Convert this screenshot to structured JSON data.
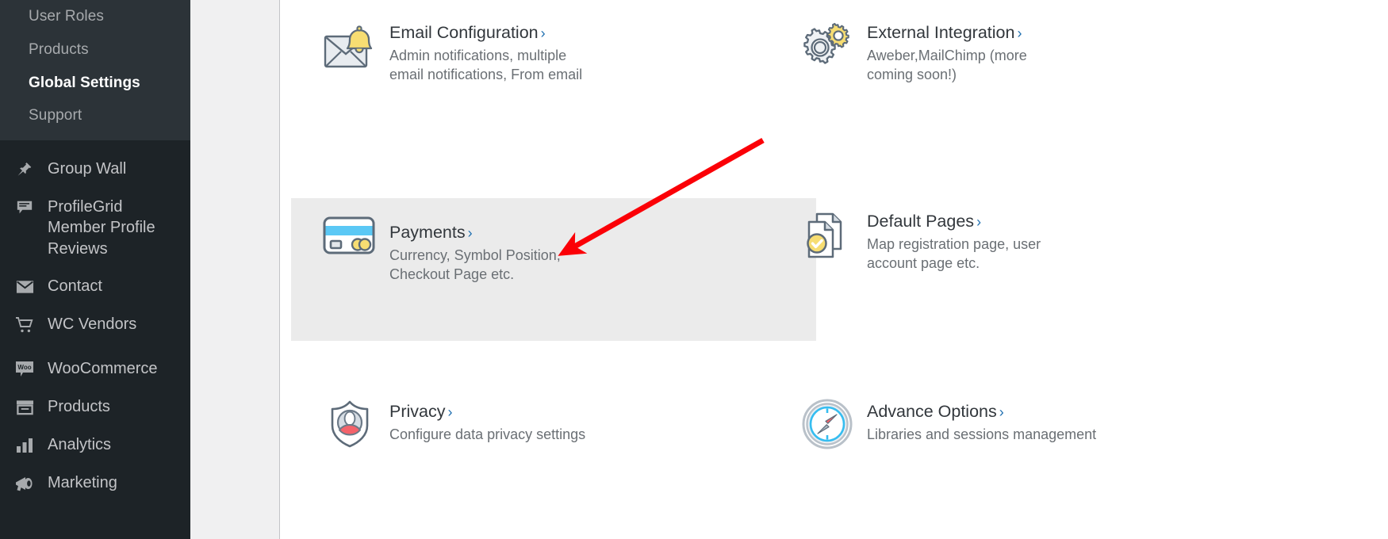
{
  "sidebar": {
    "submenu": [
      {
        "label": "User Roles",
        "current": false
      },
      {
        "label": "Products",
        "current": false
      },
      {
        "label": "Global Settings",
        "current": true
      },
      {
        "label": "Support",
        "current": false
      }
    ],
    "menu": [
      {
        "label": "Group Wall",
        "icon": "pin-icon"
      },
      {
        "label": "ProfileGrid Member Profile Reviews",
        "icon": "comment-icon"
      },
      {
        "label": "Contact",
        "icon": "envelope-icon"
      },
      {
        "label": "WC Vendors",
        "icon": "cart-icon"
      },
      {
        "label": "WooCommerce",
        "icon": "woo-icon"
      },
      {
        "label": "Products",
        "icon": "products-icon"
      },
      {
        "label": "Analytics",
        "icon": "analytics-icon"
      },
      {
        "label": "Marketing",
        "icon": "megaphone-icon"
      }
    ]
  },
  "main": {
    "cards": [
      {
        "id": "email-configuration",
        "title": "Email Configuration",
        "chevron": "›",
        "desc": "Admin notifications, multiple email notifications, From email",
        "icon": "envelope-bell-icon",
        "highlighted": false
      },
      {
        "id": "external-integration",
        "title": "External Integration",
        "chevron": "›",
        "desc": "Aweber,MailChimp (more coming soon!)",
        "icon": "gears-icon",
        "highlighted": false
      },
      {
        "id": "payments",
        "title": "Payments",
        "chevron": "›",
        "desc": "Currency, Symbol Position, Checkout Page etc.",
        "icon": "credit-card-icon",
        "highlighted": true
      },
      {
        "id": "default-pages",
        "title": "Default Pages",
        "chevron": "›",
        "desc": "Map registration page, user account page etc.",
        "icon": "documents-check-icon",
        "highlighted": false
      },
      {
        "id": "privacy",
        "title": "Privacy",
        "chevron": "›",
        "desc": "Configure data privacy settings",
        "icon": "shield-user-icon",
        "highlighted": false
      },
      {
        "id": "advance-options",
        "title": "Advance Options",
        "chevron": "›",
        "desc": "Libraries and sessions management",
        "icon": "compass-icon",
        "highlighted": false
      }
    ]
  },
  "annotation": {
    "type": "arrow",
    "color": "#fb0007",
    "points_to": "payments"
  },
  "colors": {
    "sidebar_bg": "#1d2327",
    "submenu_bg": "#2c3338",
    "gutter_bg": "#f0f0f1",
    "card_highlight_bg": "#ebebeb",
    "title": "#32373c",
    "desc": "#6a6f74",
    "link": "#2271b1",
    "accent_yellow": "#f7dd72",
    "accent_blue": "#5bc8f5",
    "accent_red": "#f4636b",
    "icon_stroke": "#5d6b79"
  }
}
